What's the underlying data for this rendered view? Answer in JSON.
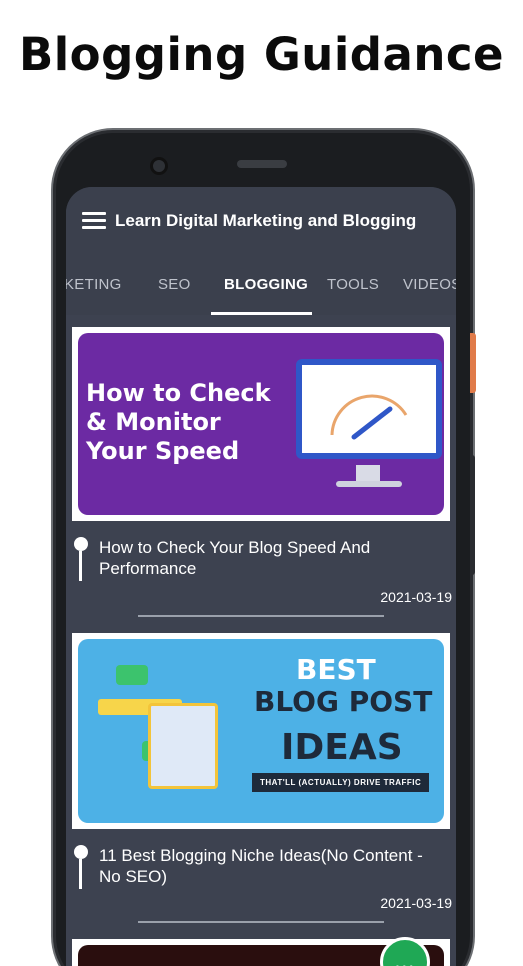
{
  "headline": "Blogging Guidance",
  "app_bar": {
    "title": "Learn Digital Marketing and Blogging",
    "menu_icon": "hamburger-menu-icon"
  },
  "tabs": [
    {
      "label": "KETING",
      "active": false
    },
    {
      "label": "SEO",
      "active": false
    },
    {
      "label": "BLOGGING",
      "active": true
    },
    {
      "label": "TOOLS",
      "active": false
    },
    {
      "label": "VIDEOS",
      "active": false
    }
  ],
  "posts": [
    {
      "thumbnail_text": [
        "How to Check",
        "& Monitor",
        "Your Speed"
      ],
      "title": "How to Check Your Blog Speed And Performance",
      "date": "2021-03-19"
    },
    {
      "thumbnail_text": {
        "line1": "BEST",
        "line2": "BLOG POST",
        "line3": "IDEAS",
        "tagline": "THAT'LL (ACTUALLY) DRIVE TRAFFIC"
      },
      "title": "11 Best Blogging Niche Ideas(No Content - No SEO)",
      "date": "2021-03-19"
    }
  ],
  "colors": {
    "app_bg": "#3d4250",
    "thumb1_bg": "#6c2aa3",
    "thumb2_bg": "#4db1e6",
    "chat_fab": "#1fa855",
    "phone_side_button": "#e07b4a"
  },
  "chat_fab_icon": "chat-bubble-icon"
}
